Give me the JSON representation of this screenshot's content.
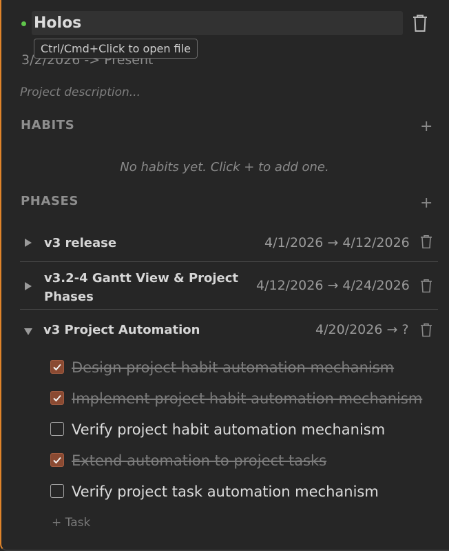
{
  "project": {
    "title": "Holos",
    "status_color": "#5fc64b",
    "dates": "3/2/2026 -> Present",
    "description_placeholder": "Project description...",
    "tooltip": "Ctrl/Cmd+Click to open file",
    "delete_icon": "trash-icon"
  },
  "habits": {
    "heading": "HABITS",
    "add_label": "+",
    "empty_text": "No habits yet. Click + to add one."
  },
  "phases": {
    "heading": "PHASES",
    "add_label": "+",
    "items": [
      {
        "name": "v3 release",
        "dates": "4/1/2026 → 4/12/2026",
        "expanded": false
      },
      {
        "name_line1": "v3.2-4 Gantt View & Project",
        "name_line2": "Phases",
        "dates": "4/12/2026 → 4/24/2026",
        "expanded": false
      },
      {
        "name": "v3 Project Automation",
        "dates": "4/20/2026 → ?",
        "expanded": true,
        "tasks": [
          {
            "label": "Design project habit automation mechanism",
            "done": true
          },
          {
            "label": "Implement project habit automation mechanism",
            "done": true
          },
          {
            "label": "Verify project habit automation mechanism",
            "done": false
          },
          {
            "label": "Extend automation to project tasks",
            "done": true
          },
          {
            "label": "Verify project task automation mechanism",
            "done": false
          }
        ],
        "add_task_label": "+ Task"
      }
    ]
  },
  "colors": {
    "accent_border": "#e0842a",
    "checkbox_checked": "#8a4a32",
    "background": "#262626"
  }
}
